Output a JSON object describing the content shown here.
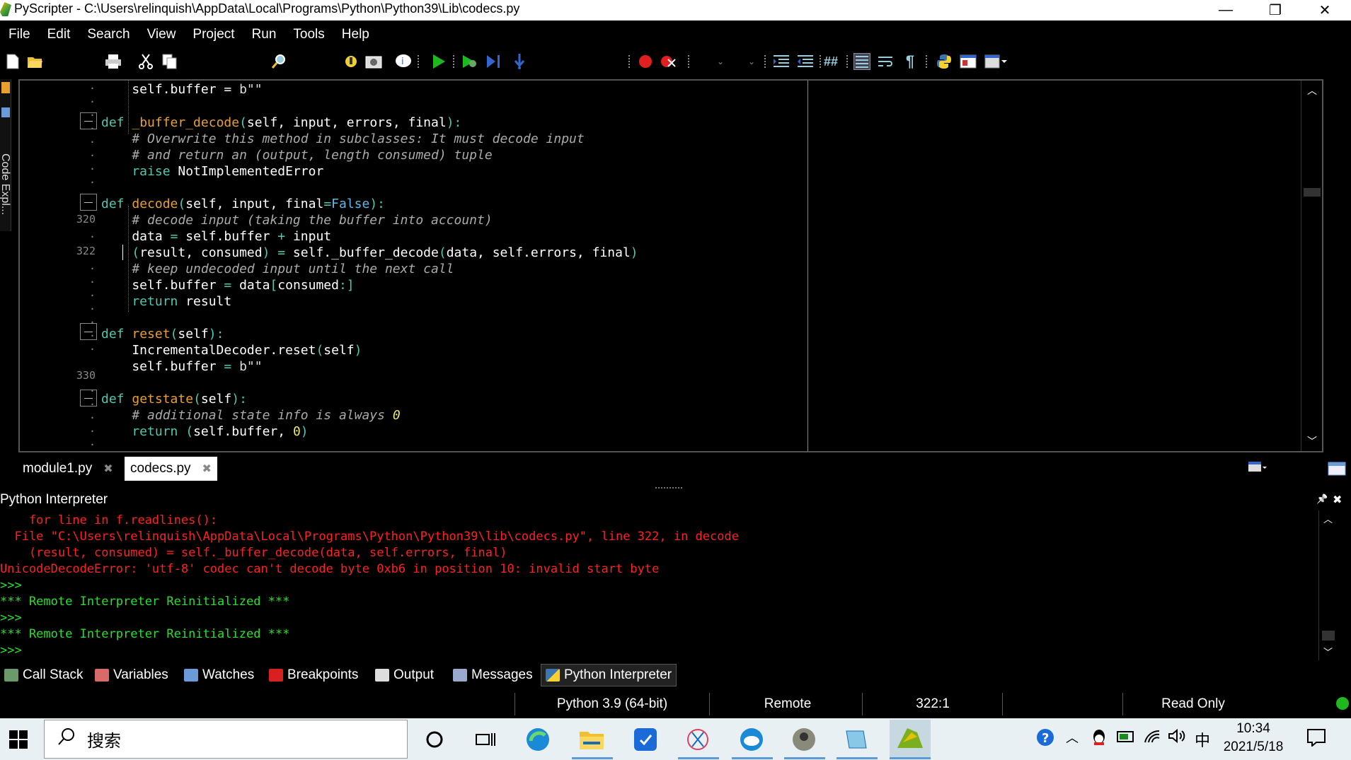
{
  "window": {
    "title": "PyScripter - C:\\Users\\relinquish\\AppData\\Local\\Programs\\Python\\Python39\\Lib\\codecs.py",
    "minimize": "—",
    "restore": "❐",
    "close": "✕"
  },
  "menu": [
    "File",
    "Edit",
    "Search",
    "View",
    "Project",
    "Run",
    "Tools",
    "Help"
  ],
  "side_panel": {
    "label": "Code Expl..."
  },
  "editor": {
    "line_numbers": [
      {
        "text": "320"
      },
      {
        "text": "322"
      },
      {
        "text": "330"
      }
    ]
  },
  "tabs": [
    {
      "label": "module1.py",
      "close": "✖"
    },
    {
      "label": "codecs.py",
      "close": "✖"
    }
  ],
  "interpreter": {
    "header": "Python Interpreter",
    "pin": "📌",
    "close": "✖",
    "lines": [
      "    for line in f.readlines():",
      "  File \"C:\\Users\\relinquish\\AppData\\Local\\Programs\\Python\\Python39\\lib\\codecs.py\", line 322, in decode",
      "    (result, consumed) = self._buffer_decode(data, self.errors, final)",
      "UnicodeDecodeError: 'utf-8' codec can't decode byte 0xb6 in position 10: invalid start byte",
      ">>>",
      "*** Remote Interpreter Reinitialized ***",
      ">>>",
      "*** Remote Interpreter Reinitialized ***",
      ">>>"
    ]
  },
  "bottom_tabs": [
    "Call Stack",
    "Variables",
    "Watches",
    "Breakpoints",
    "Output",
    "Messages",
    "Python Interpreter"
  ],
  "status": {
    "python": "Python 3.9 (64-bit)",
    "engine": "Remote",
    "position": "322:1",
    "mode": "Read Only"
  },
  "taskbar": {
    "search_placeholder": "搜索",
    "time": "10:34",
    "date": "2021/5/18",
    "ime": "中"
  },
  "colors": {
    "error_text": "#ff2020",
    "prompt_text": "#28e028",
    "keyword": "#4ec9b0",
    "function_name": "#e8a030"
  }
}
